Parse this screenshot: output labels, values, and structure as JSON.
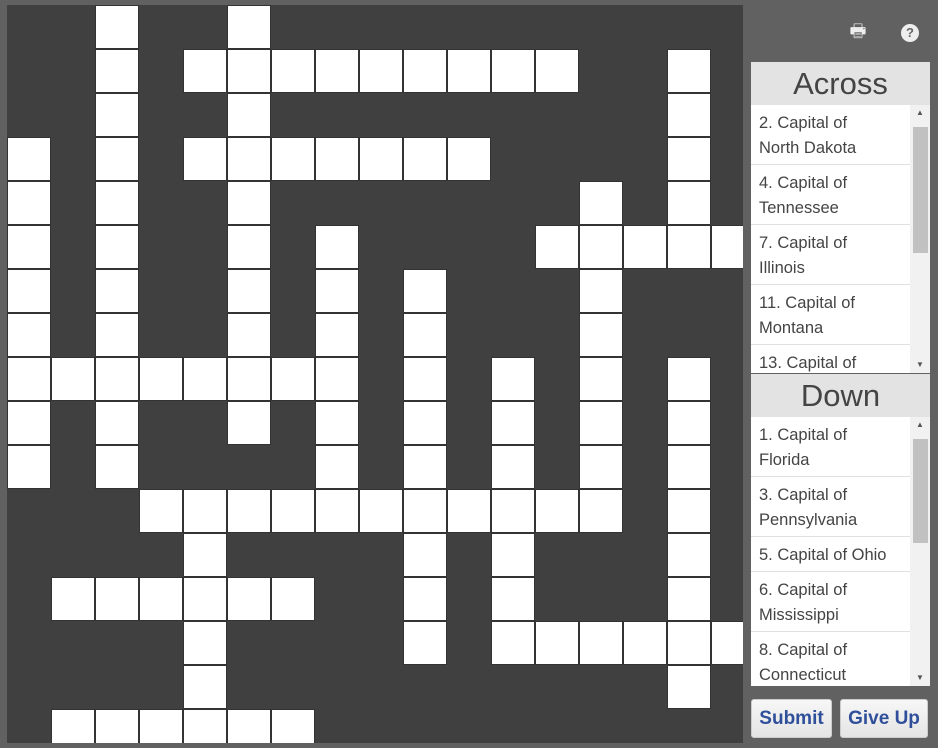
{
  "grid": [
    "..#..#...........",
    "..#.#########..#.",
    "..#..#.........#.",
    "#.#.#######....#.",
    "#.#..#.......#.#.",
    "#.#..#.#....#####",
    "#.#..#.#.#...#...",
    "#.#..#.#.#...#...",
    "########.#.#.#.#.",
    "#.#..#.#.#.#.#.#.",
    "#.#....#.#.#.#.#.",
    "...###########.#.",
    "....#....#.#...#.",
    ".######..#.#...#.",
    "....#....#.######",
    "....#..........#.",
    ".######.........."
  ],
  "colors": {
    "board": "#404040",
    "cell": "#ffffff",
    "accent": "#2f4f9a"
  },
  "toolbar": {
    "print_icon": "printer-icon",
    "help_icon": "question-circle-icon",
    "help_glyph": "?"
  },
  "across": {
    "title": "Across",
    "clues": [
      "2. Capital of North Dakota",
      "4. Capital of Tennessee",
      "7. Capital of Illinois",
      "11. Capital of Montana",
      "13. Capital of"
    ]
  },
  "down": {
    "title": "Down",
    "clues": [
      "1. Capital of Florida",
      "3. Capital of Pennsylvania",
      "5. Capital of Ohio",
      "6. Capital of Mississippi",
      "8. Capital of Connecticut"
    ]
  },
  "buttons": {
    "submit": "Submit",
    "give_up": "Give Up"
  }
}
